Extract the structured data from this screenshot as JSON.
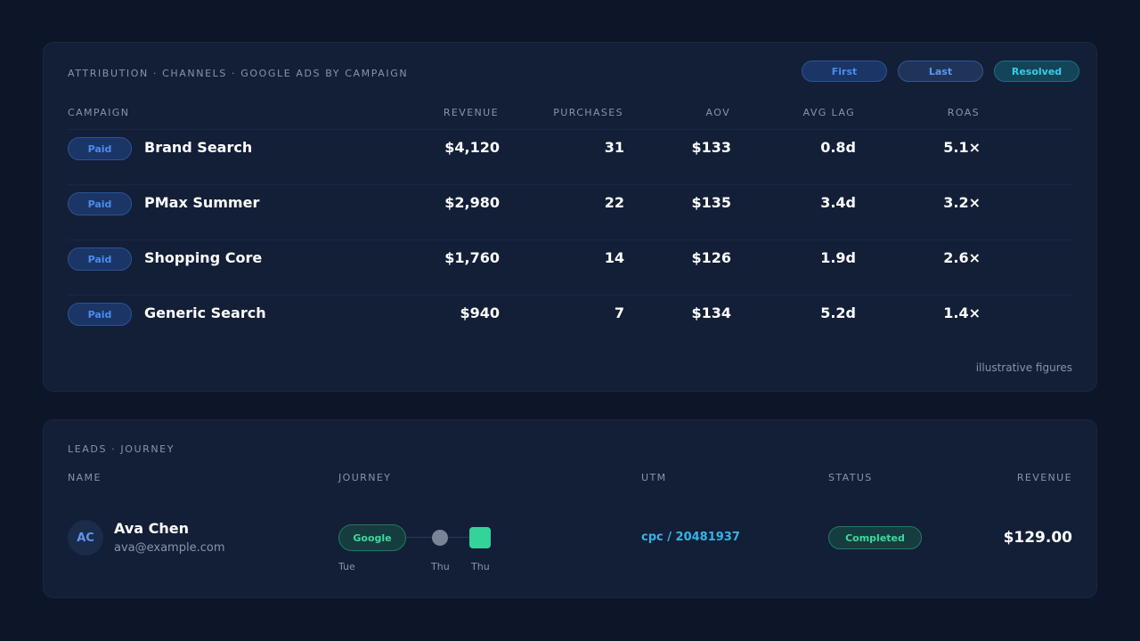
{
  "attribution": {
    "title": "ATTRIBUTION · CHANNELS · GOOGLE ADS BY CAMPAIGN",
    "toggles": [
      "First",
      "Last",
      "Resolved"
    ],
    "active_toggle": "Resolved",
    "columns": {
      "campaign": "CAMPAIGN",
      "revenue": "REVENUE",
      "purchases": "PURCHASES",
      "aov": "AOV",
      "avg_lag": "AVG LAG",
      "roas": "ROAS"
    },
    "rows": [
      {
        "badge": "Paid",
        "campaign": "Brand Search",
        "revenue": "$4,120",
        "purchases": "31",
        "aov": "$133",
        "avg_lag": "0.8d",
        "roas": "5.1×"
      },
      {
        "badge": "Paid",
        "campaign": "PMax Summer",
        "revenue": "$2,980",
        "purchases": "22",
        "aov": "$135",
        "avg_lag": "3.4d",
        "roas": "3.2×"
      },
      {
        "badge": "Paid",
        "campaign": "Shopping Core",
        "revenue": "$1,760",
        "purchases": "14",
        "aov": "$126",
        "avg_lag": "1.9d",
        "roas": "2.6×"
      },
      {
        "badge": "Paid",
        "campaign": "Generic Search",
        "revenue": "$940",
        "purchases": "7",
        "aov": "$134",
        "avg_lag": "5.2d",
        "roas": "1.4×"
      }
    ],
    "footnote": "illustrative figures"
  },
  "leads": {
    "title": "LEADS · JOURNEY",
    "columns": {
      "name": "NAME",
      "journey": "JOURNEY",
      "utm": "UTM",
      "status": "STATUS",
      "revenue": "REVENUE"
    },
    "rows": [
      {
        "initials": "AC",
        "name": "Ava Chen",
        "email": "ava@example.com",
        "journey": {
          "source": "Google",
          "days": [
            "Tue",
            "Thu",
            "Thu"
          ]
        },
        "utm": "cpc / 20481937",
        "status": "Completed",
        "revenue": "$129.00"
      }
    ]
  },
  "colors": {
    "background": "#0c1628",
    "card": "#131f37",
    "paid_badge": "#4a8cf0",
    "resolved": "#36cde9",
    "completed": "#3dd99e",
    "utm_link": "#36b4e6"
  }
}
